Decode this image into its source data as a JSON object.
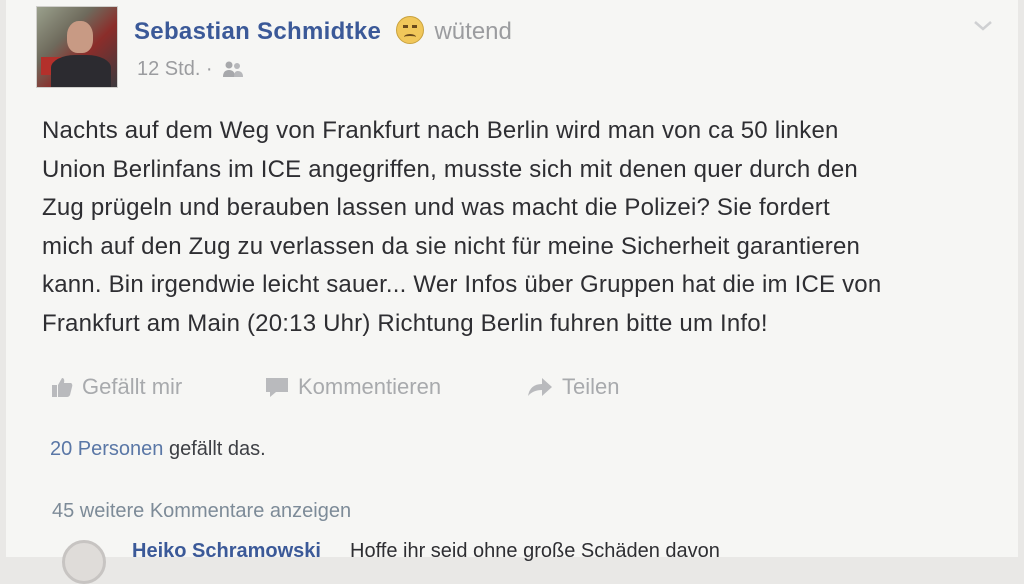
{
  "post": {
    "author": "Sebastian Schmidtke",
    "mood_icon": "angry-face-icon",
    "mood": "wütend",
    "time": "12 Std. ·",
    "audience_icon": "friends-icon",
    "text_lines": [
      "Nachts auf dem Weg von Frankfurt nach Berlin wird man von ca 50 linken",
      "Union Berlinfans im ICE angegriffen, musste sich mit denen quer durch den",
      "Zug prügeln und berauben lassen und was macht die Polizei? Sie fordert",
      "mich auf den Zug zu verlassen da sie nicht für meine Sicherheit garantieren",
      "kann. Bin irgendwie leicht sauer... Wer Infos über Gruppen hat die im ICE von",
      "Frankfurt am Main (20:13 Uhr) Richtung Berlin fuhren bitte um Info!"
    ]
  },
  "actions": {
    "like": "Gefällt mir",
    "comment": "Kommentieren",
    "share": "Teilen"
  },
  "likes": {
    "count": "20 Personen",
    "suffix": " gefällt das."
  },
  "more_comments": "45 weitere Kommentare anzeigen",
  "comment": {
    "author": "Heiko Schramowski",
    "text": "Hoffe ihr seid ohne große Schäden davon"
  },
  "colors": {
    "link_blue": "#3b5998",
    "muted_gray": "#9b9c9f",
    "background": "#f6f6f4"
  }
}
